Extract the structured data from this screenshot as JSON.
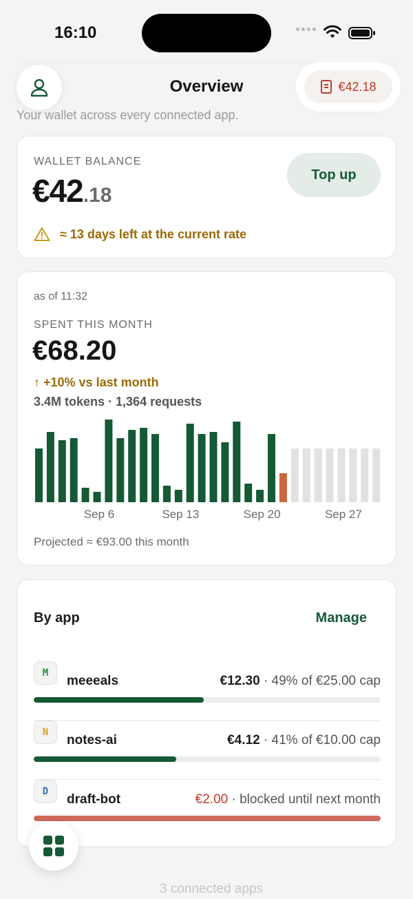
{
  "status_bar": {
    "time": "16:10"
  },
  "header": {
    "title": "Overview",
    "balance_pill": "€42.18",
    "subtitle": "Your wallet across every connected app."
  },
  "wallet": {
    "label": "WALLET BALANCE",
    "amount_main": "€42",
    "amount_cents": ".18",
    "topup_label": "Top up",
    "warning": "≈ 13 days left at the current rate"
  },
  "spending": {
    "as_of": "as of 11:32",
    "label": "SPENT THIS MONTH",
    "amount": "€68.20",
    "delta": "↑ +10% vs last month",
    "tokens": "3.4M tokens · 1,364 requests",
    "projected": "Projected ≈ €93.00 this month"
  },
  "chart_data": {
    "type": "bar",
    "x_tick_labels": [
      "Sep 6",
      "Sep 13",
      "Sep 20",
      "Sep 27"
    ],
    "ylabel": "",
    "series": [
      {
        "values": [
          2.6,
          3.4,
          3.0,
          3.1,
          0.7,
          0.5,
          4.0,
          3.1,
          3.5,
          3.6,
          3.3,
          0.8,
          0.6,
          3.8,
          3.3,
          3.4,
          2.9,
          3.9,
          0.9,
          0.6,
          3.3
        ]
      },
      {
        "values": [
          1.4
        ]
      },
      {
        "values": [
          2.6,
          2.6,
          2.6,
          2.6,
          2.6,
          2.6,
          2.6,
          2.6
        ]
      }
    ],
    "colors": {
      "actual": "#155a35",
      "today": "#c8683f",
      "projected": "#e2e2e2"
    }
  },
  "by_app": {
    "title": "By app",
    "manage_label": "Manage",
    "apps": [
      {
        "initial": "M",
        "name": "meeeals",
        "amount": "€12.30",
        "detail": " · 49% of €25.00 cap",
        "percent": 49,
        "badge_color": "#2e8b4a",
        "state": "ok"
      },
      {
        "initial": "N",
        "name": "notes-ai",
        "amount": "€4.12",
        "detail": " · 41% of €10.00 cap",
        "percent": 41,
        "badge_color": "#d9a11a",
        "state": "ok"
      },
      {
        "initial": "D",
        "name": "draft-bot",
        "amount": "€2.00",
        "detail": " · blocked until next month",
        "percent": 100,
        "badge_color": "#3b6fb0",
        "state": "blocked"
      }
    ]
  },
  "footer": {
    "connected": "3 connected apps"
  },
  "icons": {
    "profile": "person-icon",
    "receipt": "receipt-icon",
    "warning": "warning-icon",
    "apps": "grid-icon"
  }
}
